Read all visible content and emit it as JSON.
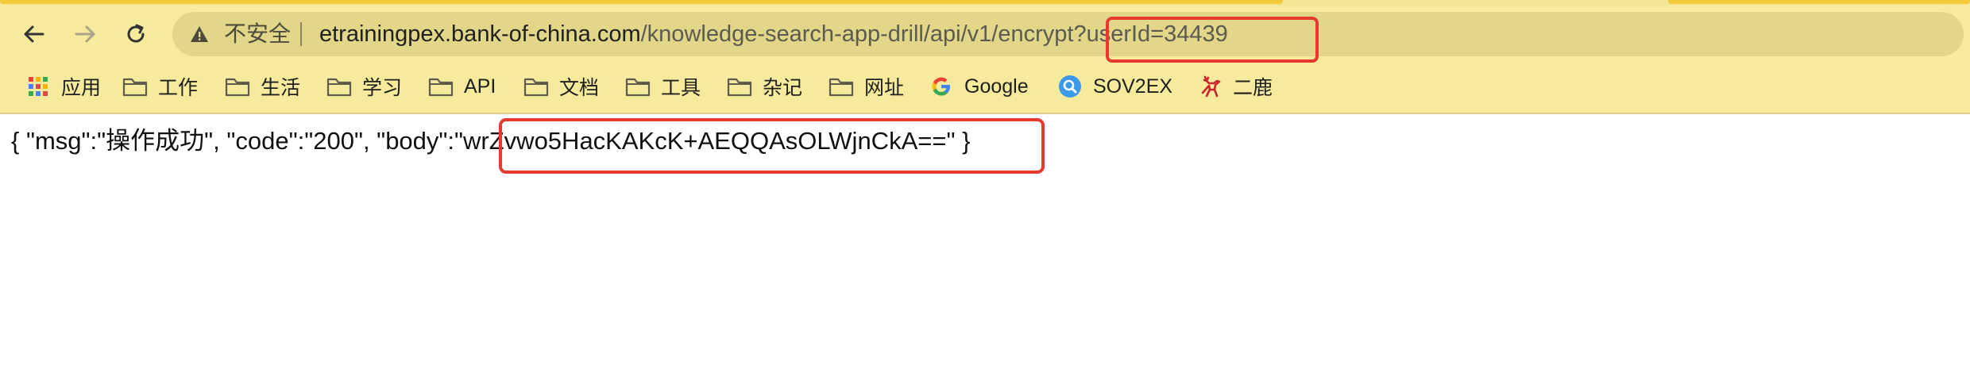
{
  "browser": {
    "insecure_label": "不安全",
    "url_host": "etrainingpex.bank-of-china.com",
    "url_path": "/knowledge-search-app-drill/api/v1/encrypt",
    "url_query": "?userId=34439"
  },
  "bookmarks": [
    {
      "label": "应用",
      "icon": "apps-grid-icon"
    },
    {
      "label": "工作",
      "icon": "folder-icon"
    },
    {
      "label": "生活",
      "icon": "folder-icon"
    },
    {
      "label": "学习",
      "icon": "folder-icon"
    },
    {
      "label": "API",
      "icon": "folder-icon"
    },
    {
      "label": "文档",
      "icon": "folder-icon"
    },
    {
      "label": "工具",
      "icon": "folder-icon"
    },
    {
      "label": "杂记",
      "icon": "folder-icon"
    },
    {
      "label": "网址",
      "icon": "folder-icon"
    },
    {
      "label": "Google",
      "icon": "google-icon"
    },
    {
      "label": "SOV2EX",
      "icon": "search-circle-icon"
    },
    {
      "label": "二鹿",
      "icon": "deer-icon"
    }
  ],
  "response": {
    "prefix": "{ \"msg\":\"操作成功\", \"code\":\"200\", \"body\":",
    "body_value": "\"wrZvwo5HacKAKcK+AEQQAsOLWjnCkA==\"",
    "suffix": " }"
  },
  "colors": {
    "toolbar_bg": "#f6ea9c",
    "omnibox_bg": "#e2d689",
    "highlight": "#e53a2e"
  }
}
